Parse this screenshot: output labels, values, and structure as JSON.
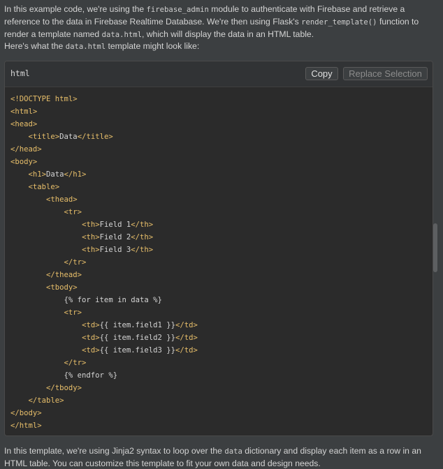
{
  "intro": {
    "t1": "In this example code, we're using the ",
    "c1": "firebase_admin",
    "t2": " module to authenticate with Firebase and retrieve a reference to the data in Firebase Realtime Database. We're then using Flask's ",
    "c2": "render_template()",
    "t3": " function to render a template named ",
    "c3": "data.html",
    "t4": ", which will display the data in an HTML table."
  },
  "lead": {
    "t1": "Here's what the ",
    "c1": "data.html",
    "t2": " template might look like:"
  },
  "code_block": {
    "language": "html",
    "copy_label": "Copy",
    "replace_label": "Replace Selection",
    "lines": [
      [
        [
          "tag",
          "<!DOCTYPE html>"
        ]
      ],
      [
        [
          "tag",
          "<html>"
        ]
      ],
      [
        [
          "tag",
          "<head>"
        ]
      ],
      [
        [
          "txt",
          "    "
        ],
        [
          "tag",
          "<title>"
        ],
        [
          "txt",
          "Data"
        ],
        [
          "tag",
          "</title>"
        ]
      ],
      [
        [
          "tag",
          "</head>"
        ]
      ],
      [
        [
          "tag",
          "<body>"
        ]
      ],
      [
        [
          "txt",
          "    "
        ],
        [
          "tag",
          "<h1>"
        ],
        [
          "txt",
          "Data"
        ],
        [
          "tag",
          "</h1>"
        ]
      ],
      [
        [
          "txt",
          "    "
        ],
        [
          "tag",
          "<table>"
        ]
      ],
      [
        [
          "txt",
          "        "
        ],
        [
          "tag",
          "<thead>"
        ]
      ],
      [
        [
          "txt",
          "            "
        ],
        [
          "tag",
          "<tr>"
        ]
      ],
      [
        [
          "txt",
          "                "
        ],
        [
          "tag",
          "<th>"
        ],
        [
          "txt",
          "Field 1"
        ],
        [
          "tag",
          "</th>"
        ]
      ],
      [
        [
          "txt",
          "                "
        ],
        [
          "tag",
          "<th>"
        ],
        [
          "txt",
          "Field 2"
        ],
        [
          "tag",
          "</th>"
        ]
      ],
      [
        [
          "txt",
          "                "
        ],
        [
          "tag",
          "<th>"
        ],
        [
          "txt",
          "Field 3"
        ],
        [
          "tag",
          "</th>"
        ]
      ],
      [
        [
          "txt",
          "            "
        ],
        [
          "tag",
          "</tr>"
        ]
      ],
      [
        [
          "txt",
          "        "
        ],
        [
          "tag",
          "</thead>"
        ]
      ],
      [
        [
          "txt",
          "        "
        ],
        [
          "tag",
          "<tbody>"
        ]
      ],
      [
        [
          "txt",
          "            {% for item in data %}"
        ]
      ],
      [
        [
          "txt",
          "            "
        ],
        [
          "tag",
          "<tr>"
        ]
      ],
      [
        [
          "txt",
          "                "
        ],
        [
          "tag",
          "<td>"
        ],
        [
          "txt",
          "{{ item.field1 }}"
        ],
        [
          "tag",
          "</td>"
        ]
      ],
      [
        [
          "txt",
          "                "
        ],
        [
          "tag",
          "<td>"
        ],
        [
          "txt",
          "{{ item.field2 }}"
        ],
        [
          "tag",
          "</td>"
        ]
      ],
      [
        [
          "txt",
          "                "
        ],
        [
          "tag",
          "<td>"
        ],
        [
          "txt",
          "{{ item.field3 }}"
        ],
        [
          "tag",
          "</td>"
        ]
      ],
      [
        [
          "txt",
          "            "
        ],
        [
          "tag",
          "</tr>"
        ]
      ],
      [
        [
          "txt",
          "            {% endfor %}"
        ]
      ],
      [
        [
          "txt",
          "        "
        ],
        [
          "tag",
          "</tbody>"
        ]
      ],
      [
        [
          "txt",
          "    "
        ],
        [
          "tag",
          "</table>"
        ]
      ],
      [
        [
          "tag",
          "</body>"
        ]
      ],
      [
        [
          "tag",
          "</html>"
        ]
      ]
    ]
  },
  "outro": {
    "t1": "In this template, we're using Jinja2 syntax to loop over the ",
    "c1": "data",
    "t2": " dictionary and display each item as a row in an HTML table. You can customize this template to fit your own data and design needs."
  },
  "colors": {
    "background": "#3c3f41",
    "code_background": "#2b2b2b",
    "tag": "#e8bf6a",
    "text": "#d4d4d4"
  }
}
